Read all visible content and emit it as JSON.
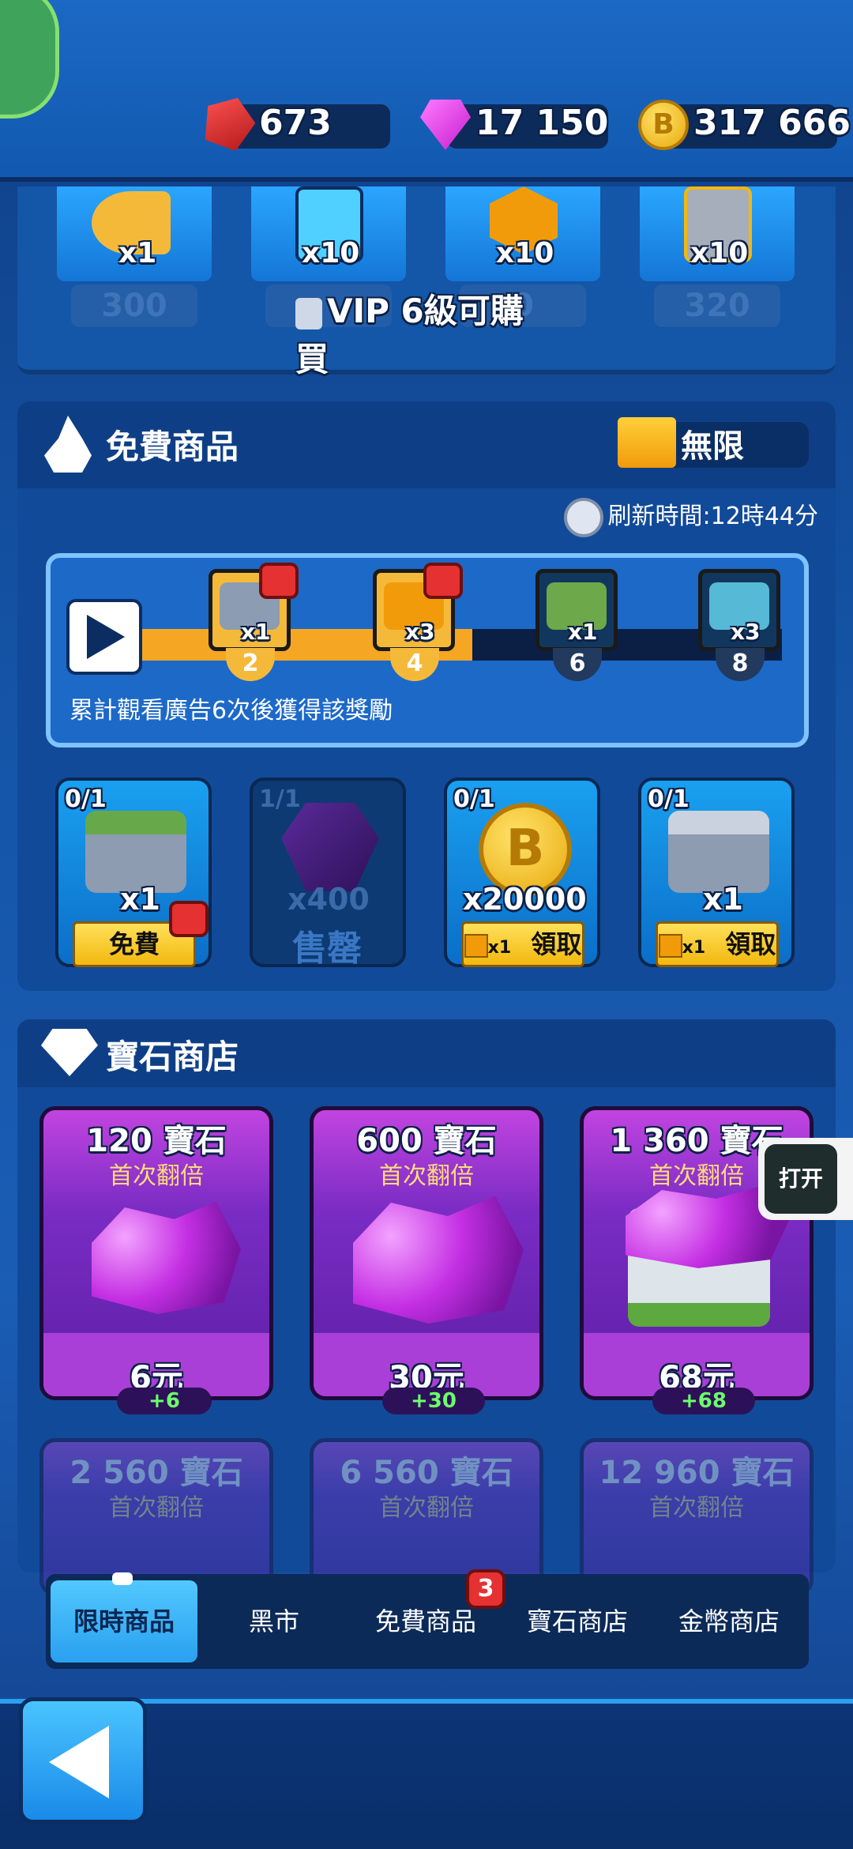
{
  "currencies": {
    "ruby": "673",
    "gems": "17 150",
    "coins": "317 666"
  },
  "vip_strip": {
    "items": [
      {
        "qty": "x1",
        "price": "300"
      },
      {
        "qty": "x10",
        "price": ""
      },
      {
        "qty": "x10",
        "price": "0"
      },
      {
        "qty": "x10",
        "price": "320"
      }
    ],
    "lock_label": "VIP 6級可購買"
  },
  "free_section": {
    "title": "免費商品",
    "ticket_label": "無限",
    "refresh": "刷新時間:12時44分",
    "ad_progress": {
      "milestones": [
        {
          "qty": "x1",
          "step": "2"
        },
        {
          "qty": "x3",
          "step": "4"
        },
        {
          "qty": "x1",
          "step": "6"
        },
        {
          "qty": "x3",
          "step": "8"
        }
      ],
      "caption": "累計觀看廣告6次後獲得該獎勵"
    },
    "cards": [
      {
        "count": "0/1",
        "qty": "x1",
        "button": "免費"
      },
      {
        "count": "1/1",
        "qty": "x400",
        "button": "售罄"
      },
      {
        "count": "0/1",
        "qty": "x20000",
        "button": "領取",
        "ticket": "x1"
      },
      {
        "count": "0/1",
        "qty": "x1",
        "button": "領取",
        "ticket": "x1"
      }
    ]
  },
  "gem_shop": {
    "title": "寶石商店",
    "cards": [
      {
        "title": "120 寶石",
        "sub": "首次翻倍",
        "price": "6元",
        "bonus": "+6"
      },
      {
        "title": "600 寶石",
        "sub": "首次翻倍",
        "price": "30元",
        "bonus": "+30"
      },
      {
        "title": "1 360 寶石",
        "sub": "首次翻倍",
        "price": "68元",
        "bonus": "+68"
      },
      {
        "title": "2 560 寶石",
        "sub": "首次翻倍"
      },
      {
        "title": "6 560 寶石",
        "sub": "首次翻倍"
      },
      {
        "title": "12 960 寶石",
        "sub": "首次翻倍"
      }
    ]
  },
  "open_chip": "打开",
  "tabs": [
    {
      "label": "限時商品",
      "active": true
    },
    {
      "label": "黑市"
    },
    {
      "label": "免費商品",
      "badge": "3"
    },
    {
      "label": "寶石商店"
    },
    {
      "label": "金幣商店"
    }
  ],
  "colors": {
    "background": "#1555a8",
    "accent_gold": "#f5b93a",
    "active_tab": "#2aa0f0",
    "gem_card": "#7a2cc4"
  }
}
